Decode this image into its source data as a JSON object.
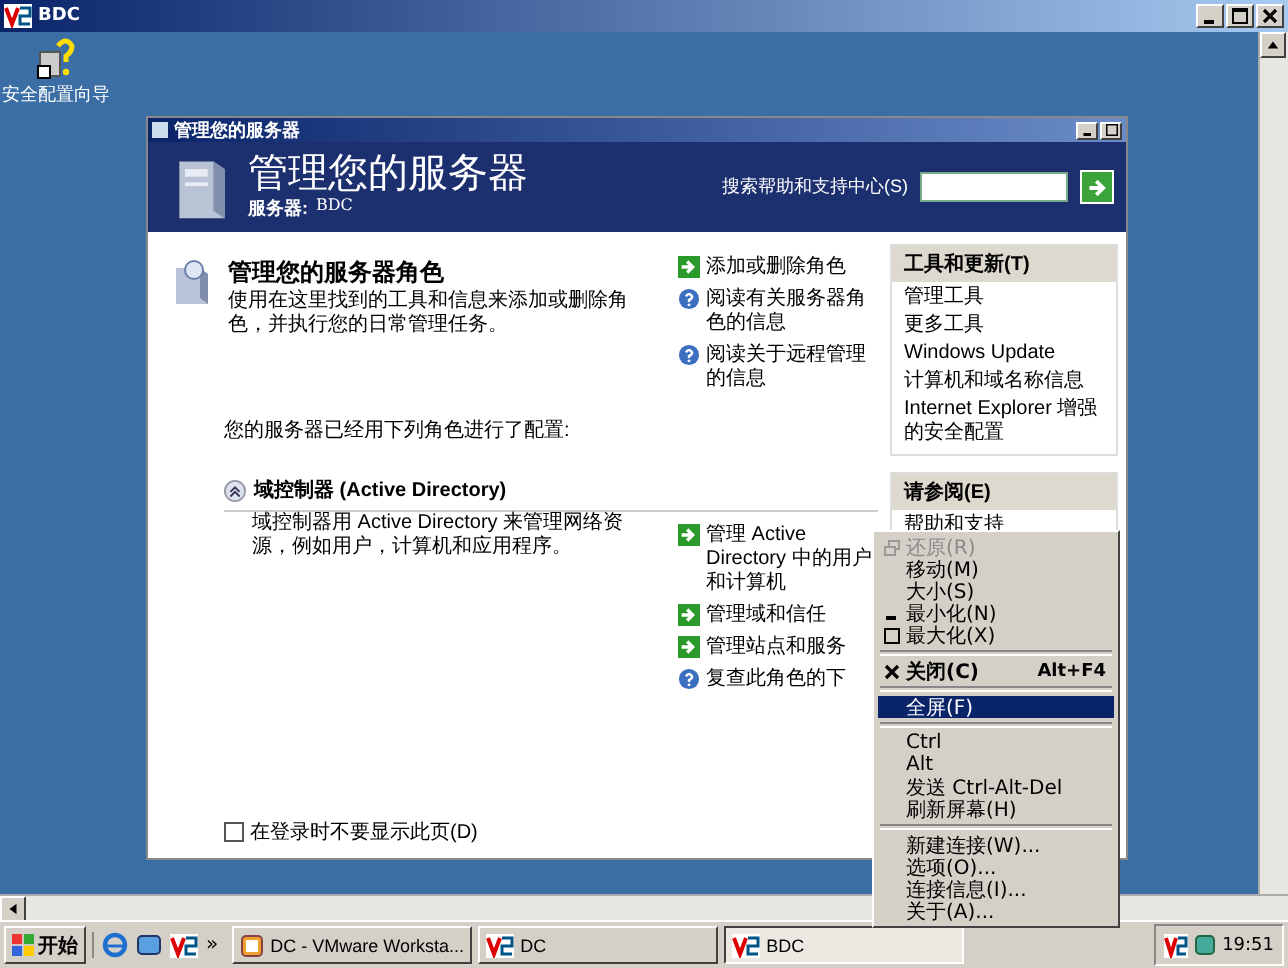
{
  "window": {
    "title": "BDC"
  },
  "desktop_icons": [
    {
      "label": "安全配置向导"
    }
  ],
  "app": {
    "title": "管理您的服务器",
    "heading": "管理您的服务器",
    "server_label": "服务器:",
    "server_name": "BDC",
    "search_label": "搜索帮助和支持中心(S)",
    "roles_section": {
      "title": "管理您的服务器角色",
      "description": "使用在这里找到的工具和信息来添加或删除角色，并执行您的日常管理任务。",
      "links": [
        {
          "kind": "action",
          "label": "添加或删除角色"
        },
        {
          "kind": "help",
          "label": "阅读有关服务器角色的信息"
        },
        {
          "kind": "help",
          "label": "阅读关于远程管理的信息"
        }
      ]
    },
    "configured_text": "您的服务器已经用下列角色进行了配置:",
    "role": {
      "title": "域控制器 (Active Directory)",
      "description": "域控制器用 Active Directory 来管理网络资源，例如用户，计算机和应用程序。",
      "links": [
        {
          "kind": "action",
          "label": "管理 Active Directory 中的用户和计算机"
        },
        {
          "kind": "action",
          "label": "管理域和信任"
        },
        {
          "kind": "action",
          "label": "管理站点和服务"
        },
        {
          "kind": "help",
          "label": "复查此角色的下"
        }
      ]
    },
    "dont_show": {
      "label": "在登录时不要显示此页(D)",
      "checked": false
    },
    "panels": [
      {
        "title": "工具和更新(T)",
        "items": [
          "管理工具",
          "更多工具",
          "Windows Update",
          "计算机和域名称信息",
          "Internet Explorer 增强的安全配置"
        ]
      },
      {
        "title": "请参阅(E)",
        "items": [
          "帮助和支持"
        ]
      }
    ]
  },
  "menu": {
    "groups": [
      [
        {
          "kind": "restore",
          "label": "还原(R)",
          "disabled": true,
          "selected": false
        },
        {
          "kind": "plain",
          "label": "移动(M)",
          "disabled": false,
          "selected": false
        },
        {
          "kind": "plain",
          "label": "大小(S)",
          "disabled": false,
          "selected": false
        },
        {
          "kind": "minimize",
          "label": "最小化(N)",
          "disabled": false,
          "selected": false
        },
        {
          "kind": "maximize",
          "label": "最大化(X)",
          "disabled": false,
          "selected": false
        }
      ],
      [
        {
          "kind": "close",
          "label": "关闭(C)",
          "shortcut": "Alt+F4",
          "disabled": false,
          "selected": false
        }
      ],
      [
        {
          "kind": "plain",
          "label": "全屏(F)",
          "disabled": false,
          "selected": true
        }
      ],
      [
        {
          "kind": "plain",
          "label": "Ctrl",
          "disabled": false,
          "selected": false
        },
        {
          "kind": "plain",
          "label": "Alt",
          "disabled": false,
          "selected": false
        },
        {
          "kind": "plain",
          "label": "发送 Ctrl-Alt-Del",
          "disabled": false,
          "selected": false
        },
        {
          "kind": "plain",
          "label": "刷新屏幕(H)",
          "disabled": false,
          "selected": false
        }
      ],
      [
        {
          "kind": "plain",
          "label": "新建连接(W)...",
          "disabled": false,
          "selected": false
        },
        {
          "kind": "plain",
          "label": "选项(O)...",
          "disabled": false,
          "selected": false
        },
        {
          "kind": "plain",
          "label": "连接信息(I)...",
          "disabled": false,
          "selected": false
        },
        {
          "kind": "plain",
          "label": "关于(A)...",
          "disabled": false,
          "selected": false
        }
      ]
    ]
  },
  "taskbar": {
    "start": "开始",
    "more": "»",
    "tasks": [
      {
        "label": "DC - VMware Worksta...",
        "kind": "vmware",
        "selected": false
      },
      {
        "label": "DC",
        "kind": "vnc",
        "selected": false
      },
      {
        "label": "BDC",
        "kind": "vnc",
        "selected": true
      }
    ],
    "clock": "19:51"
  }
}
